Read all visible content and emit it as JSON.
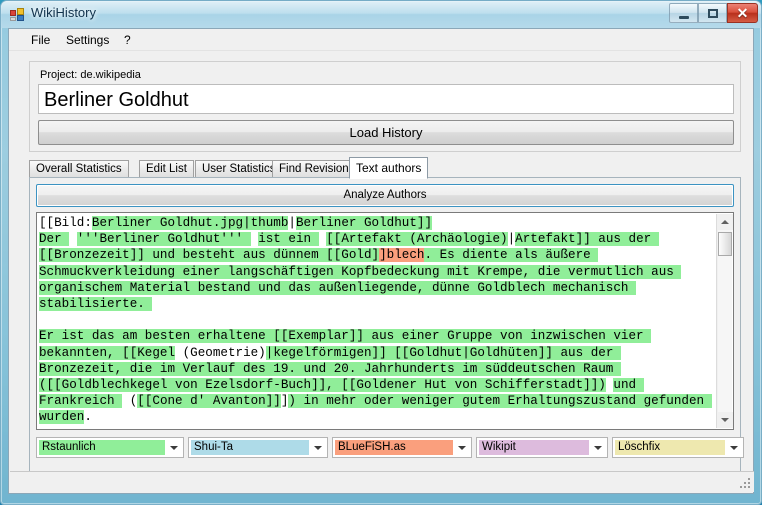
{
  "window": {
    "title": "WikiHistory",
    "icon": "app-window-icon",
    "controls": {
      "minimize": "minimize-icon",
      "maximize": "maximize-icon",
      "close": "✕"
    }
  },
  "menu": {
    "items": [
      {
        "label": "File"
      },
      {
        "label": "Settings"
      },
      {
        "label": "?"
      }
    ]
  },
  "project": {
    "label": "Project: de.wikipedia",
    "article_value": "Berliner Goldhut",
    "article_placeholder": "",
    "load_button": "Load History"
  },
  "tabs": [
    {
      "label": "Overall Statistics",
      "active": false
    },
    {
      "label": "Edit List",
      "active": false
    },
    {
      "label": "User Statistics",
      "active": false
    },
    {
      "label": "Find Revisions",
      "active": false
    },
    {
      "label": "Text authors",
      "active": true
    }
  ],
  "text_authors": {
    "analyze_button": "Analyze Authors",
    "scrollbar": {
      "up_arrow": "scroll-up-icon",
      "down_arrow": "scroll-down-icon"
    },
    "lines": [
      [
        {
          "t": "[[Bild:",
          "h": "none"
        },
        {
          "t": "Berliner Goldhut.",
          "h": "green"
        },
        {
          "t": "jpg|thumb",
          "h": "green"
        },
        {
          "t": "|",
          "h": "none"
        },
        {
          "t": "Berliner Goldhut]]",
          "h": "green"
        }
      ],
      [
        {
          "t": "Der ",
          "h": "green"
        },
        {
          "t": " ",
          "h": "none"
        },
        {
          "t": "'''Berliner Goldhut''' ",
          "h": "green"
        },
        {
          "t": " ",
          "h": "none"
        },
        {
          "t": "ist ein ",
          "h": "green"
        },
        {
          "t": " ",
          "h": "none"
        },
        {
          "t": "[[Artefakt (Archäologie)",
          "h": "green"
        },
        {
          "t": "|",
          "h": "none"
        },
        {
          "t": "Artefakt]] aus der ",
          "h": "green"
        }
      ],
      [
        {
          "t": "[[Bronzezeit]] und besteht aus dünnem [[Gold]",
          "h": "green"
        },
        {
          "t": "]blech",
          "h": "orange"
        },
        {
          "t": ". Es diente als äußere ",
          "h": "green"
        }
      ],
      [
        {
          "t": "Schmuckverkleidung einer langschäftigen Kopfbedeckung mit Krempe, die vermutlich aus ",
          "h": "green"
        }
      ],
      [
        {
          "t": "organischem Material bestand und das außenliegende, dünne Goldblech mechanisch ",
          "h": "green"
        }
      ],
      [
        {
          "t": "stabilisierte. ",
          "h": "green"
        }
      ],
      [
        {
          "t": "",
          "h": "none"
        }
      ],
      [
        {
          "t": "Er ist das am besten erhaltene [[Exemplar]] aus einer Gruppe von inzwischen vier ",
          "h": "green"
        }
      ],
      [
        {
          "t": "bekannten, [[Kegel",
          "h": "green"
        },
        {
          "t": " (Geometrie)",
          "h": "none"
        },
        {
          "t": "|",
          "h": "green"
        },
        {
          "t": "kegelförmigen]] [[Goldhut|Goldhüten]] aus der ",
          "h": "green"
        }
      ],
      [
        {
          "t": "Bronzezeit, die im Verlauf des 19. und 20. Jahrhunderts im süddeutschen Raum ",
          "h": "green"
        }
      ],
      [
        {
          "t": "([[Goldblechkegel von Ezelsdorf-Buch]], [[Goldener Hut von Schifferstadt]]",
          "h": "green"
        },
        {
          "t": ")",
          "h": "green"
        },
        {
          "t": " ",
          "h": "none"
        },
        {
          "t": "und ",
          "h": "green"
        }
      ],
      [
        {
          "t": "Frankreich ",
          "h": "green"
        },
        {
          "t": " (",
          "h": "none"
        },
        {
          "t": "[[Cone d' Avanton]]",
          "h": "green"
        },
        {
          "t": "]",
          "h": "none"
        },
        {
          "t": ") in mehr oder weniger gutem Erhaltungszustand gefunden ",
          "h": "green"
        }
      ],
      [
        {
          "t": "wurden",
          "h": "green"
        },
        {
          "t": ".",
          "h": "none"
        }
      ]
    ],
    "authors": [
      {
        "name": "Rstaunlich",
        "color": "#90ee99"
      },
      {
        "name": "Shui-Ta",
        "color": "#aedbe8"
      },
      {
        "name": "BLueFiSH.as",
        "color": "#fa9f7d"
      },
      {
        "name": "Wikipit",
        "color": "#ddbbdd"
      },
      {
        "name": "Löschfix",
        "color": "#eee8af"
      }
    ]
  },
  "statusbar": {
    "text": "",
    "grip": "resize-grip-icon"
  }
}
